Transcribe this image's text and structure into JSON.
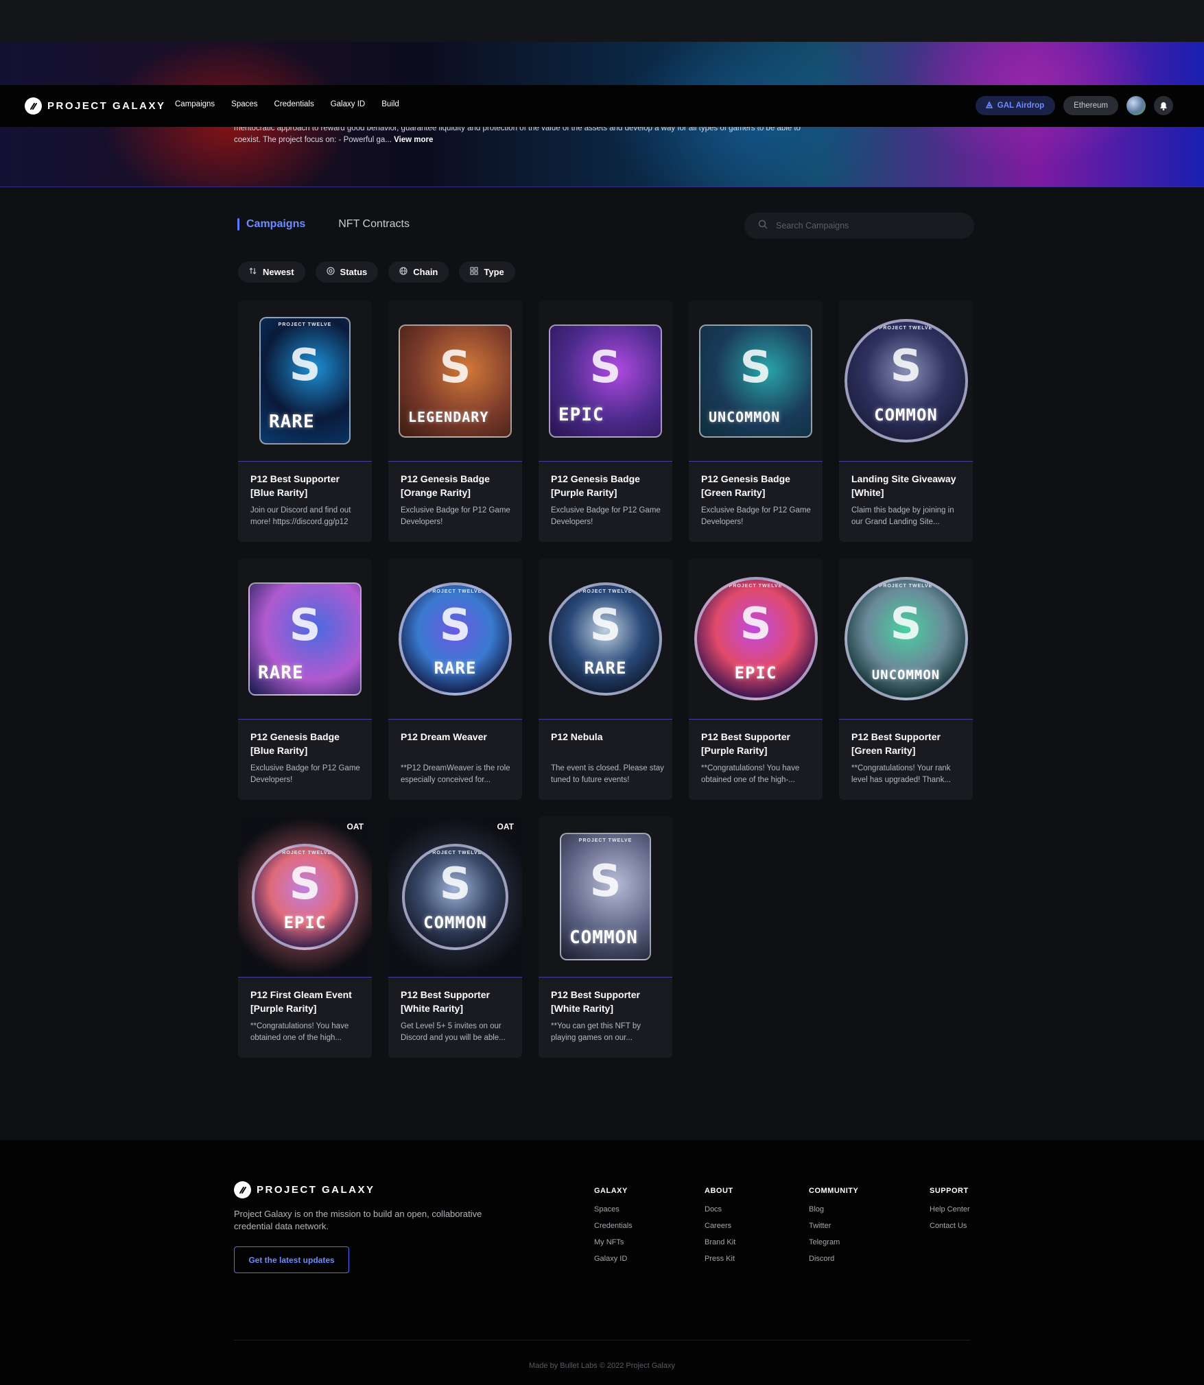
{
  "banner": {
    "description": "meritocratic approach to reward good behavior, guarantee liquidity and protection of the value of the assets and develop a way for all types of gamers to be able to coexist. The project focus on: - Powerful ga...",
    "view_more": "View more"
  },
  "navbar": {
    "logo_text": "PROJECT GALAXY",
    "links": [
      "Campaigns",
      "Spaces",
      "Credentials",
      "Galaxy ID",
      "Build"
    ],
    "gal_airdrop": "GAL Airdrop",
    "network": "Ethereum"
  },
  "tabs": {
    "campaigns": "Campaigns",
    "nft_contracts": "NFT Contracts"
  },
  "search": {
    "placeholder": "Search Campaigns"
  },
  "filters": {
    "sort": "Newest",
    "status": "Status",
    "chain": "Chain",
    "type": "Type"
  },
  "cards": [
    {
      "title": "P12 Best Supporter [Blue Rarity]",
      "desc": "Join our Discord and find out more! https://discord.gg/p12",
      "art_word": "RARE",
      "art_top": "PROJECT TWELVE",
      "shape": "tall",
      "colors": [
        "#0b3a6e",
        "#1e90d6",
        "#0a1a3a"
      ]
    },
    {
      "title": "P12 Genesis Badge [Orange Rarity]",
      "desc": "Exclusive Badge for P12 Game Developers!",
      "art_word": "LEGENDARY",
      "art_top": "",
      "shape": "rect",
      "colors": [
        "#3a1b12",
        "#d47a3a",
        "#7a3a2a"
      ]
    },
    {
      "title": "P12 Genesis Badge [Purple Rarity]",
      "desc": "Exclusive Badge for P12 Game Developers!",
      "art_word": "EPIC",
      "art_top": "",
      "shape": "rect",
      "colors": [
        "#2a1450",
        "#b04ae0",
        "#4a2a8a"
      ]
    },
    {
      "title": "P12 Genesis Badge [Green Rarity]",
      "desc": "Exclusive Badge for P12 Game Developers!",
      "art_word": "UNCOMMON",
      "art_top": "",
      "shape": "rect",
      "colors": [
        "#0c2e3a",
        "#2aa6a8",
        "#1a3a5a"
      ]
    },
    {
      "title": "Landing Site Giveaway [White]",
      "desc": "Claim this badge by joining in our Grand Landing Site...",
      "art_word": "COMMON",
      "art_top": "PROJECT TWELVE",
      "shape": "circle",
      "colors": [
        "#1a1d3a",
        "#8a8fb8",
        "#2e3260"
      ]
    },
    {
      "title": "P12 Genesis Badge [Blue Rarity]",
      "desc": "Exclusive Badge for P12 Game Developers!",
      "art_word": "RARE",
      "art_top": "",
      "shape": "rect",
      "colors": [
        "#121a4a",
        "#4a6ae0",
        "#b05ad0"
      ]
    },
    {
      "title": "P12 Dream Weaver",
      "desc": "**P12 DreamWeaver is the role especially conceived for...",
      "art_word": "RARE",
      "art_top": "PROJECT TWELVE",
      "shape": "circle-sm",
      "colors": [
        "#101840",
        "#6a5ae0",
        "#3a7ad0"
      ]
    },
    {
      "title": "P12 Nebula",
      "desc": "The event is closed. Please stay tuned to future events!",
      "art_word": "RARE",
      "art_top": "PROJECT TWELVE",
      "shape": "circle-sm",
      "colors": [
        "#0e1a30",
        "#c0d0e0",
        "#2a4a7a"
      ]
    },
    {
      "title": "P12 Best Supporter [Purple Rarity]",
      "desc": "**Congratulations! You have obtained one of the high-...",
      "art_word": "EPIC",
      "art_top": "PROJECT TWELVE",
      "shape": "circle",
      "colors": [
        "#2a0e4a",
        "#c04ae0",
        "#e04a6a"
      ]
    },
    {
      "title": "P12 Best Supporter [Green Rarity]",
      "desc": "**Congratulations! Your rank level has upgraded! Thank...",
      "art_word": "UNCOMMON",
      "art_top": "PROJECT TWELVE",
      "shape": "circle",
      "colors": [
        "#0a2a2a",
        "#4ad0a0",
        "#6a8a9a"
      ]
    },
    {
      "title": "P12 First Gleam Event [Purple Rarity]",
      "desc": "**Congratulations! You have obtained one of the high...",
      "art_word": "EPIC",
      "art_top": "PROJECT TWELVE",
      "shape": "circle-oat",
      "oat": "OAT",
      "colors": [
        "#2a1a4a",
        "#c080e0",
        "#e06a7a"
      ]
    },
    {
      "title": "P12 Best Supporter [White Rarity]",
      "desc": "Get Level 5+ 5 invites on our Discord and you will be able...",
      "art_word": "COMMON",
      "art_top": "PROJECT TWELVE",
      "shape": "circle-oat",
      "oat": "OAT",
      "colors": [
        "#141a2a",
        "#a0b4d8",
        "#3a4a6a"
      ]
    },
    {
      "title": "P12 Best Supporter [White Rarity]",
      "desc": "**You can get this NFT by playing games on our...",
      "art_word": "COMMON",
      "art_top": "PROJECT TWELVE",
      "shape": "tall",
      "colors": [
        "#1a1e2e",
        "#b8bed8",
        "#5a6080"
      ]
    }
  ],
  "footer": {
    "logo_text": "PROJECT GALAXY",
    "tagline": "Project Galaxy is on the mission to build an open, collaborative credential data network.",
    "cta": "Get the latest updates",
    "columns": [
      {
        "heading": "GALAXY",
        "links": [
          "Spaces",
          "Credentials",
          "My NFTs",
          "Galaxy ID"
        ]
      },
      {
        "heading": "ABOUT",
        "links": [
          "Docs",
          "Careers",
          "Brand Kit",
          "Press Kit"
        ]
      },
      {
        "heading": "COMMUNITY",
        "links": [
          "Blog",
          "Twitter",
          "Telegram",
          "Discord"
        ]
      },
      {
        "heading": "SUPPORT",
        "links": [
          "Help Center",
          "Contact Us"
        ]
      }
    ],
    "copyright": "Made by Bullet Labs © 2022 Project Galaxy"
  },
  "icons": {
    "logo": "galaxy-logo-icon",
    "bell": "bell-icon",
    "search": "search-icon",
    "sort": "sort-icon",
    "status": "status-icon",
    "chain": "globe-icon",
    "type": "grid-icon",
    "airdrop": "airdrop-icon"
  }
}
